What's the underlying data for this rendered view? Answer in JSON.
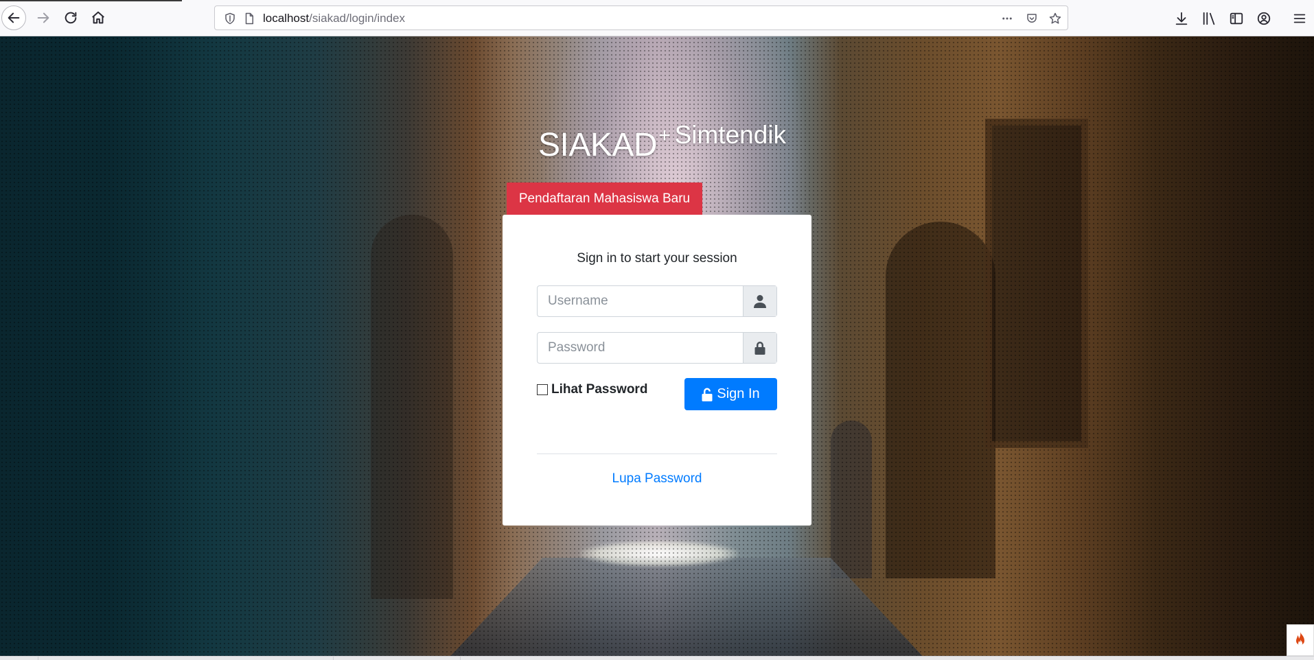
{
  "browser": {
    "url_host": "localhost",
    "url_path": "/siakad/login/index",
    "icons": {
      "back": "back-arrow-icon",
      "forward": "forward-arrow-icon",
      "reload": "reload-icon",
      "home": "home-icon",
      "shield": "tracking-shield-icon",
      "page": "page-info-icon",
      "more": "more-dots-icon",
      "pocket": "pocket-icon",
      "bookmark": "bookmark-star-icon",
      "downloads": "download-icon",
      "library": "library-icon",
      "sidebar": "sidebar-icon",
      "account": "account-icon",
      "menu": "hamburger-menu-icon"
    }
  },
  "brand": {
    "main": "SIAKAD",
    "plus": "+",
    "sub": "Simtendik"
  },
  "register_tab": {
    "label": "Pendaftaran Mahasiswa Baru",
    "color": "#dc3545"
  },
  "login": {
    "title": "Sign in to start your session",
    "username_placeholder": "Username",
    "password_placeholder": "Password",
    "show_password_label": "Lihat Password",
    "show_password_checked": false,
    "signin_label": "Sign In",
    "forgot_label": "Lupa Password",
    "accent_color": "#007bff"
  }
}
